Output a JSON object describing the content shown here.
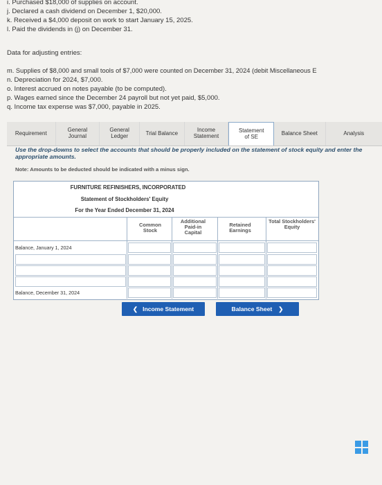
{
  "transactions": [
    "i. Purchased $18,000 of supplies on account.",
    "j. Declared a cash dividend on December 1, $20,000.",
    "k. Received a $4,000 deposit on work to start January 15, 2025.",
    "l. Paid the dividends in (j) on December 31."
  ],
  "adjusting": {
    "heading": "Data for adjusting entries:",
    "items": [
      "m. Supplies of $8,000 and small tools of $7,000 were counted on December 31, 2024 (debit Miscellaneous E",
      "n. Depreciation for 2024, $7,000.",
      "o. Interest accrued on notes payable (to be computed).",
      "p. Wages earned since the December 24 payroll but not yet paid, $5,000.",
      "q. Income tax expense was $7,000, payable in 2025."
    ]
  },
  "tabs": {
    "requirement": "Requirement",
    "general_journal": "General Journal",
    "general_ledger": "General Ledger",
    "trial_balance": "Trial Balance",
    "income_statement": "Income Statement",
    "statement_se": "Statement of SE",
    "balance_sheet": "Balance Sheet",
    "analysis": "Analysis"
  },
  "instructions": "Use the drop-downs to select the accounts that should be properly included on the statement of stock equity and enter the appropriate amounts.",
  "note": "Note: Amounts to be deducted should be indicated with a minus sign.",
  "statement": {
    "company": "FURNITURE REFINISHERS, INCORPORATED",
    "title": "Statement of Stockholders' Equity",
    "period": "For the Year Ended December 31, 2024",
    "columns": {
      "common_stock": "Common Stock",
      "apic": "Additional Paid-in Capital",
      "retained": "Retained Earnings",
      "total": "Total Stockholders' Equity"
    },
    "rows": {
      "beginning": "Balance, January 1, 2024",
      "ending": "Balance, December 31, 2024"
    }
  },
  "nav": {
    "prev": "Income Statement",
    "next": "Balance Sheet"
  }
}
